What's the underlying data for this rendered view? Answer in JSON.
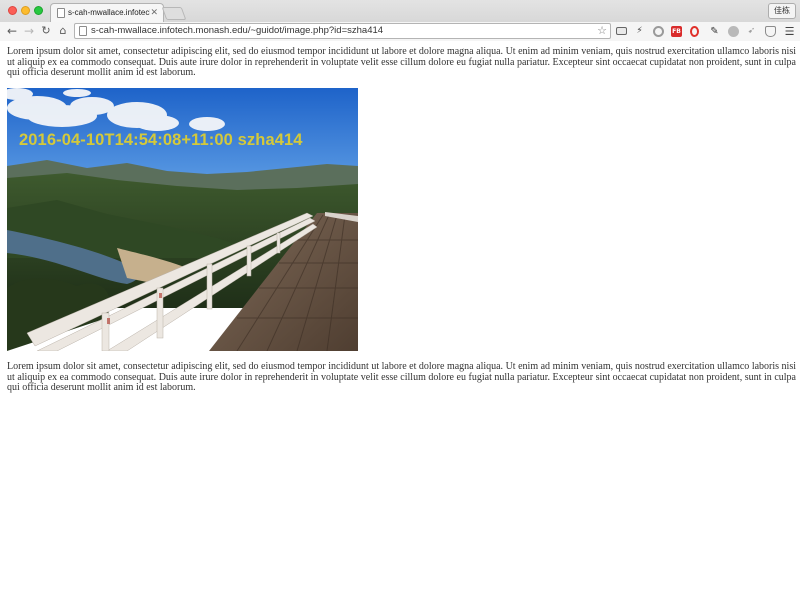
{
  "browser": {
    "tab": {
      "title": "s-cah-mwallace.infotech.m",
      "close_icon": "close-icon"
    },
    "profile_label": "佳栋",
    "address_bar": {
      "url": "s-cah-mwallace.infotech.monash.edu/~guidot/image.php?id=szha414"
    },
    "nav": {
      "back": "←",
      "forward": "→",
      "reload": "↻",
      "home": "⌂"
    },
    "extensions": [
      "mail-icon",
      "bolt-icon",
      "circle-icon",
      "facebook-extension-icon",
      "opera-icon",
      "evernote-icon",
      "gray-extension-icon",
      "feather-icon",
      "shield-icon",
      "menu-icon"
    ],
    "extension_fb_label": "FB"
  },
  "page": {
    "paragraph_1": "Lorem ipsum dolor sit amet, consectetur adipiscing elit, sed do eiusmod tempor incididunt ut labore et dolore magna aliqua. Ut enim ad minim veniam, quis nostrud exercitation ullamco laboris nisi ut aliquip ex ea commodo consequat. Duis aute irure dolor in reprehenderit in voluptate velit esse cillum dolore eu fugiat nulla pariatur. Excepteur sint occaecat cupidatat non proident, sunt in culpa qui officia deserunt mollit anim id est laborum.",
    "image_caption_overlay": "2016-04-10T14:54:08+11:00 szha414",
    "paragraph_2": "Lorem ipsum dolor sit amet, consectetur adipiscing elit, sed do eiusmod tempor incididunt ut labore et dolore magna aliqua. Ut enim ad minim veniam, quis nostrud exercitation ullamco laboris nisi ut aliquip ex ea commodo consequat. Duis aute irure dolor in reprehenderit in voluptate velit esse cillum dolore eu fugiat nulla pariatur. Excepteur sint occaecat cupidatat non proident, sunt in culpa qui officia deserunt mollit anim id est laborum."
  },
  "colors": {
    "stamp_text": "#d4c93a",
    "sky": "#2e6fd0",
    "foliage": "#2d3f22",
    "railing": "#e9e3dc",
    "deck": "#6b5644"
  }
}
